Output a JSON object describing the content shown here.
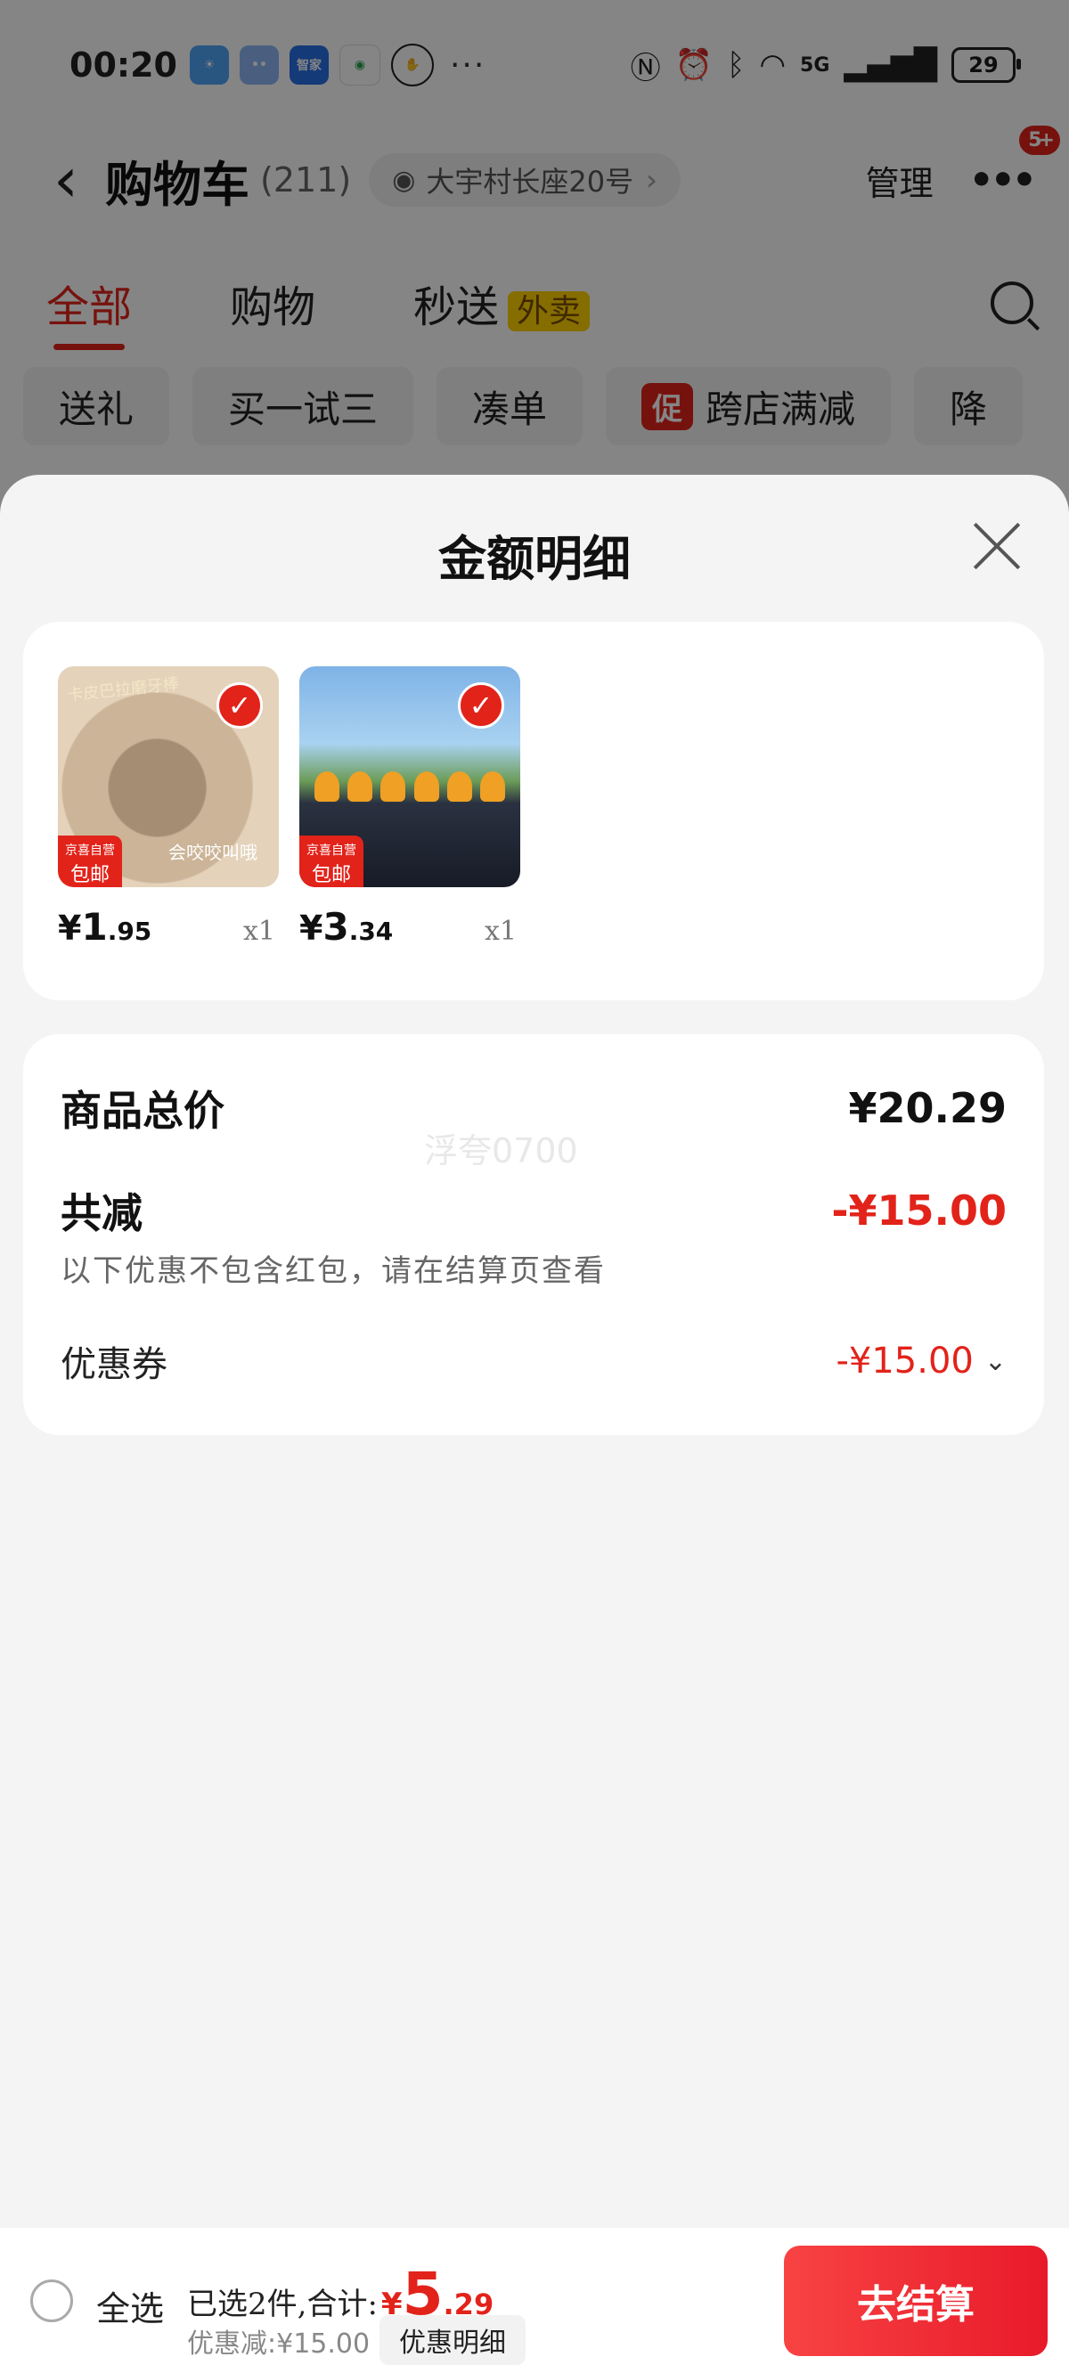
{
  "status_bar": {
    "time": "00:20",
    "apps": [
      {
        "icon": "weather-icon",
        "color": "#4fa3f7",
        "label": ""
      },
      {
        "icon": "chat-bot-icon",
        "color": "#8fb7f5",
        "label": ""
      },
      {
        "icon": "smart-home-icon",
        "color": "#2a6fe6",
        "label": "智家"
      },
      {
        "icon": "china-mobile-icon",
        "color": "#ffffff",
        "label": ""
      },
      {
        "icon": "hand-icon",
        "color": "#ffffff",
        "label": ""
      }
    ],
    "more": "···",
    "signal": "5G",
    "battery": "29"
  },
  "header": {
    "title": "购物车",
    "count": "(211)",
    "address": "大宇村长座20号",
    "manage": "管理",
    "badge": "5+"
  },
  "tabs": [
    {
      "label": "全部",
      "active": true
    },
    {
      "label": "购物"
    },
    {
      "label": "秒送",
      "pill": "外卖"
    }
  ],
  "chips": [
    {
      "label": "送礼"
    },
    {
      "label": "买一试三"
    },
    {
      "label": "凑单"
    },
    {
      "label": "跨店满减",
      "badge": "促"
    },
    {
      "label": "降"
    }
  ],
  "sheet": {
    "title": "金额明细",
    "products": [
      {
        "caption": "卡皮巴拉磨牙棒",
        "caption2": "会咬咬叫哦",
        "tag_top": "京喜自营",
        "tag_bottom": "包邮",
        "currency": "¥",
        "price_int": "1",
        "price_dec": ".95",
        "qty": "x1"
      },
      {
        "caption": "",
        "caption2": "",
        "tag_top": "京喜自营",
        "tag_bottom": "包邮",
        "currency": "¥",
        "price_int": "3",
        "price_dec": ".34",
        "qty": "x1"
      }
    ],
    "summary": {
      "total_label": "商品总价",
      "total_value": "¥20.29",
      "watermark": "浮夸0700",
      "reduce_label": "共减",
      "reduce_value": "-¥15.00",
      "note": "以下优惠不包含红包，请在结算页查看",
      "coupon_label": "优惠券",
      "coupon_value": "-¥15.00"
    }
  },
  "bottom_bar": {
    "select_all": "全选",
    "sum_label": "已选2件,合计:",
    "sum_currency": "¥",
    "sum_int": "5",
    "sum_dec": ".29",
    "discount": "优惠减:¥15.00",
    "detail_button": "优惠明细",
    "checkout": "去结算"
  },
  "colors": {
    "accent": "#e2231a",
    "sheet_bg": "#f4f4f4"
  }
}
